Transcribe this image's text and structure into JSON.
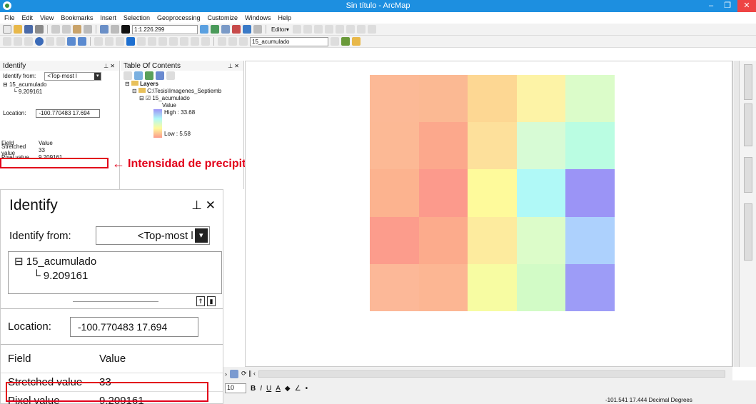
{
  "window": {
    "title": "Sin título - ArcMap"
  },
  "menu": [
    "File",
    "Edit",
    "View",
    "Bookmarks",
    "Insert",
    "Selection",
    "Geoprocessing",
    "Customize",
    "Windows",
    "Help"
  ],
  "toolbar": {
    "scale": "1:1.226.299",
    "editor_label": "Editor▾",
    "layer_select": "15_acumulado"
  },
  "identify_small": {
    "title": "Identify",
    "from_label": "Identify from:",
    "from_value": "<Top-most l",
    "tree_layer": "15_acumulado",
    "tree_value": "9.209161",
    "location_label": "Location:",
    "location_value": "-100.770483  17.694",
    "field_header": "Field",
    "value_header": "Value",
    "rows": [
      {
        "field": "Stretched value",
        "value": "33"
      },
      {
        "field": "Pixel value",
        "value": "9.209161"
      }
    ]
  },
  "toc": {
    "title": "Table Of Contents",
    "layers_label": "Layers",
    "folder": "C:\\Tesis\\Imagenes_Septiemb",
    "layer": "15_acumulado",
    "value_label": "Value",
    "high": "High : 33.68",
    "low": "Low : 5.58"
  },
  "annotation": {
    "text": "Intensidad de precipitación"
  },
  "identify_big": {
    "title": "Identify",
    "from_label": "Identify from:",
    "from_value": "<Top-most l",
    "tree_layer": "15_acumulado",
    "tree_value": "9.209161",
    "location_label": "Location:",
    "location_value": "-100.770483  17.694",
    "field_header": "Field",
    "value_header": "Value",
    "rows": [
      {
        "field": "Stretched value",
        "value": "33"
      },
      {
        "field": "Pixel value",
        "value": "9.209161"
      }
    ]
  },
  "raster_colors": [
    [
      "#fcb996",
      "#fbb993",
      "#fdd793",
      "#fdf3a6",
      "#dbfcc9"
    ],
    [
      "#fcb995",
      "#fca88c",
      "#fde09b",
      "#d7fbd5",
      "#bafde2"
    ],
    [
      "#fcb38f",
      "#fc9a8c",
      "#fefa9b",
      "#b0f9f7",
      "#9b94f6"
    ],
    [
      "#fc9c8c",
      "#fcab8c",
      "#fdeb9e",
      "#dcfcc9",
      "#add1fd"
    ],
    [
      "#fcb898",
      "#fcb693",
      "#f7fca2",
      "#d2fbc6",
      "#9d9cf7"
    ]
  ],
  "font_size": "10",
  "status": {
    "coords": "-101.541  17.444 Decimal Degrees"
  }
}
